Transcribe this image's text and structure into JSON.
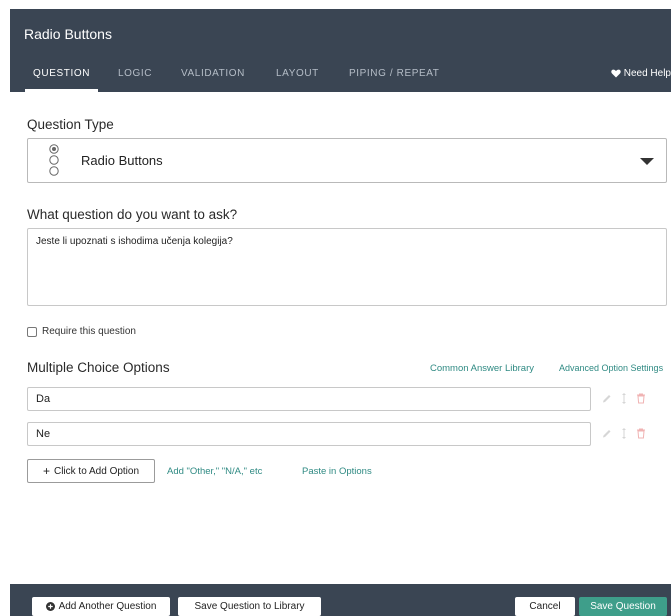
{
  "header": {
    "title": "Radio Buttons",
    "tabs": [
      {
        "label": "QUESTION",
        "active": true
      },
      {
        "label": "LOGIC",
        "active": false
      },
      {
        "label": "VALIDATION",
        "active": false
      },
      {
        "label": "LAYOUT",
        "active": false
      },
      {
        "label": "PIPING / REPEAT",
        "active": false
      }
    ],
    "help_label": "Need Help",
    "help_icon": "heart-icon"
  },
  "question_type": {
    "label": "Question Type",
    "selected": "Radio Buttons",
    "icon": "radio-buttons-icon"
  },
  "question_text": {
    "label": "What question do you want to ask?",
    "value": "Jeste li upoznati s ishodima učenja kolegija?"
  },
  "require": {
    "label": "Require this question",
    "checked": false
  },
  "options": {
    "label": "Multiple Choice Options",
    "common_library_link": "Common Answer Library",
    "advanced_settings_link": "Advanced Option Settings",
    "items": [
      {
        "value": "Da"
      },
      {
        "value": "Ne"
      }
    ],
    "add_option_label": "Click to Add Option",
    "add_other_link": "Add \"Other,\" \"N/A,\" etc",
    "paste_link": "Paste in Options"
  },
  "footer": {
    "add_another_label": "Add Another Question",
    "save_library_label": "Save Question to Library",
    "cancel_label": "Cancel",
    "save_label": "Save Question"
  },
  "colors": {
    "header_bg": "#3a4553",
    "accent_link": "#2f8a83",
    "save_green": "#3e9e8a",
    "delete_red": "#f0b3b3"
  }
}
